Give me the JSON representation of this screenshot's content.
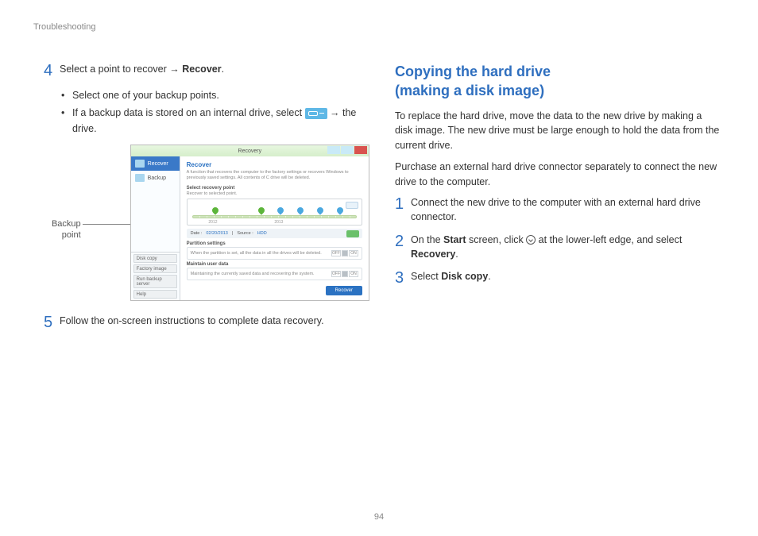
{
  "header": "Troubleshooting",
  "page_number": "94",
  "left": {
    "step4": {
      "num": "4",
      "text_a": "Select a point to recover → ",
      "text_b": "Recover",
      "text_c": "."
    },
    "bullets": {
      "b1": "Select one of your backup points.",
      "b2_a": "If a backup data is stored on an internal drive, select ",
      "b2_b": " → the drive."
    },
    "callout": "Backup point",
    "step5": {
      "num": "5",
      "text": "Follow the on-screen instructions to complete data recovery."
    }
  },
  "right": {
    "heading_a": "Copying the hard drive",
    "heading_b": "(making a disk image)",
    "p1": "To replace the hard drive, move the data to the new drive by making a disk image. The new drive must be large enough to hold the data from the current drive.",
    "p2": "Purchase an external hard drive connector separately to connect the new drive to the computer.",
    "s1": {
      "num": "1",
      "text": "Connect the new drive to the computer with an external hard drive connector."
    },
    "s2": {
      "num": "2",
      "a": "On the ",
      "b": "Start",
      "c": " screen, click ",
      "d": " at the lower-left edge, and select ",
      "e": "Recovery",
      "f": "."
    },
    "s3": {
      "num": "3",
      "a": "Select ",
      "b": "Disk copy",
      "c": "."
    }
  },
  "shot": {
    "title": "Recovery",
    "side": {
      "recover": "Recover",
      "backup": "Backup",
      "disk_copy": "Disk copy",
      "factory_image": "Factory image",
      "run_backup_server": "Run backup server",
      "help": "Help"
    },
    "main": {
      "title": "Recover",
      "desc": "A function that recovers the computer to the factory settings or recovers Windows to previously saved settings. All contents of C drive will be deleted.",
      "sel_label": "Select recovery point",
      "sel_sub": "Recover to selected point.",
      "tl_left": "2012",
      "tl_right": "2013",
      "date_label": "Date :",
      "date_val": "02/20/2013",
      "src_label": "Source :",
      "src_val": "HDD",
      "part_label": "Partition settings",
      "part_txt": "When the partition is set, all the data in all the drives will be deleted.",
      "maint_label": "Maintain user data",
      "maint_txt": "Maintaining the currently saved data and recovering the system.",
      "off": "OFF",
      "on": "ON",
      "recover_btn": "Recover"
    }
  },
  "chart_data": {
    "type": "timeline",
    "range_labels": [
      "2012",
      "2013"
    ],
    "markers": [
      {
        "position_pct": 12,
        "kind": "green"
      },
      {
        "position_pct": 40,
        "kind": "green"
      },
      {
        "position_pct": 52,
        "kind": "blue"
      },
      {
        "position_pct": 64,
        "kind": "blue"
      },
      {
        "position_pct": 76,
        "kind": "blue"
      },
      {
        "position_pct": 88,
        "kind": "blue"
      }
    ],
    "selected_date": "02/20/2013",
    "source": "HDD"
  }
}
